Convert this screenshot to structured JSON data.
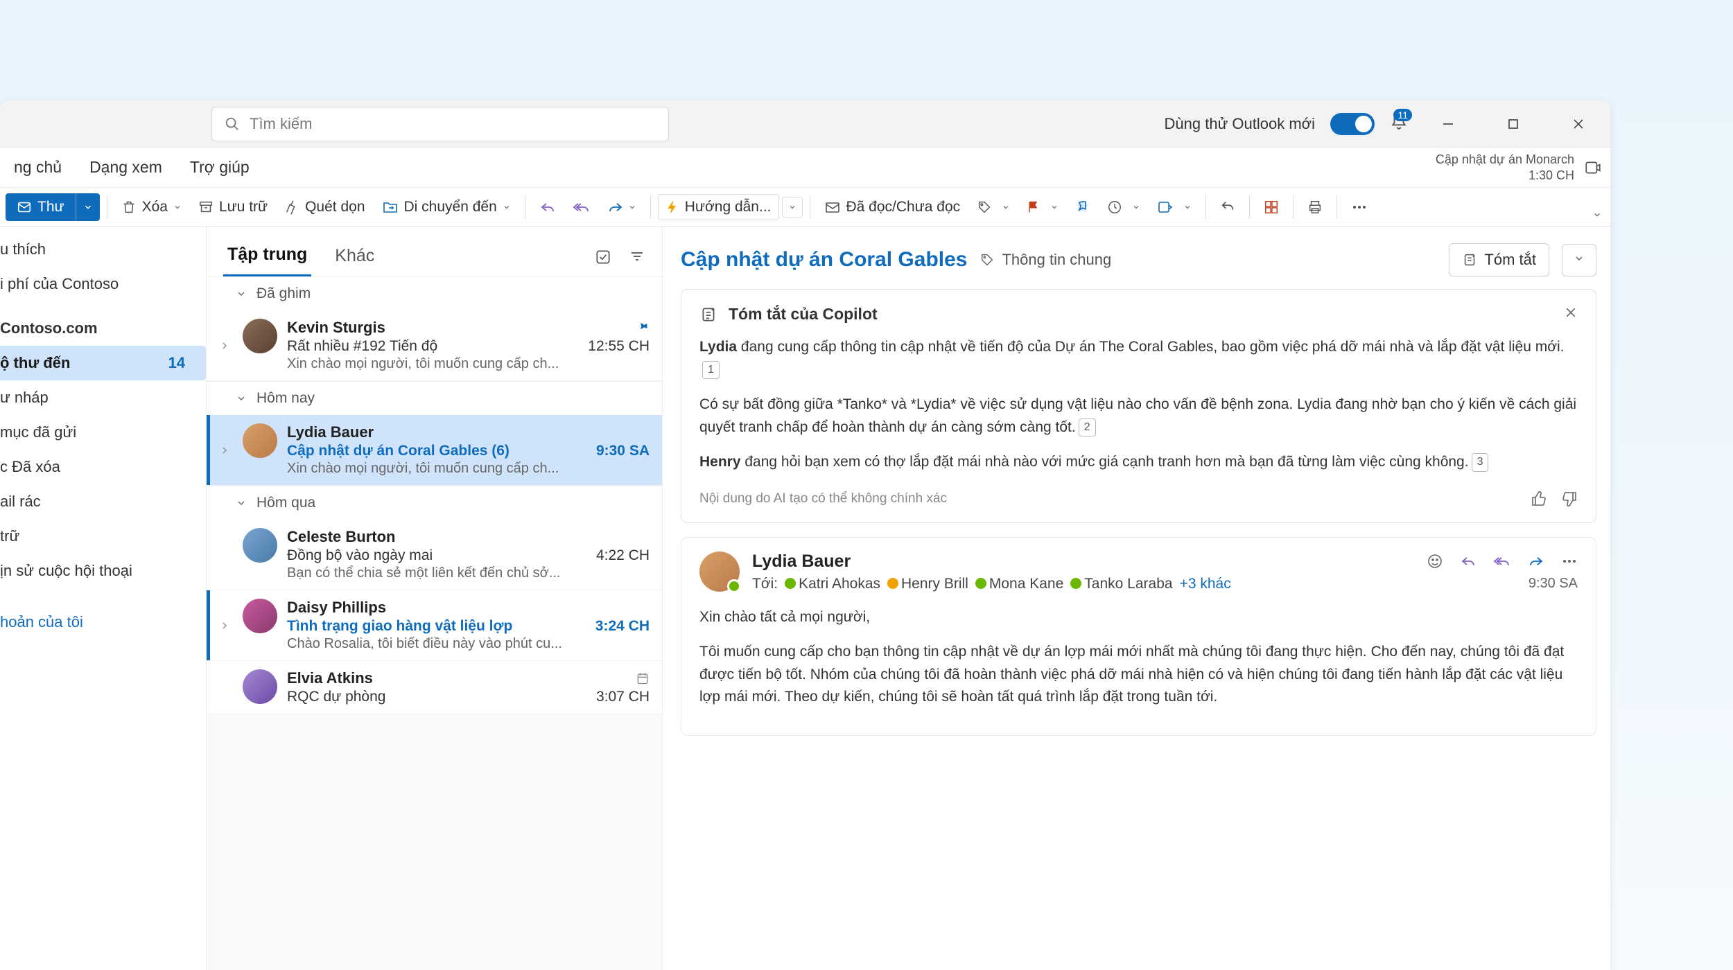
{
  "titlebar": {
    "search_placeholder": "Tìm kiếm",
    "try_new": "Dùng thử Outlook mới",
    "notification_count": "11"
  },
  "tabs": {
    "home": "ng chủ",
    "view": "Dạng xem",
    "help": "Trợ giúp"
  },
  "meeting": {
    "title": "Cập nhật dự án Monarch",
    "time": "1:30 CH"
  },
  "ribbon": {
    "new_mail": "Thư",
    "delete": "Xóa",
    "archive": "Lưu trữ",
    "sweep": "Quét dọn",
    "move": "Di chuyển đến",
    "guide": "Hướng dẫn...",
    "read_unread": "Đã đọc/Chưa đọc"
  },
  "folders": {
    "favorites": "u thích",
    "contoso_fees": "i phí của Contoso",
    "contoso_com": "Contoso.com",
    "inbox": "ộ thư đến",
    "inbox_count": "14",
    "drafts": "ư nháp",
    "sent": " mục đã gửi",
    "deleted": "c Đã xóa",
    "junk": "ail rác",
    "archive": " trữ",
    "history": "ịn sử cuộc hội thoại",
    "my_account": "hoản của tôi"
  },
  "msg_tabs": {
    "focused": "Tập trung",
    "other": "Khác"
  },
  "sections": {
    "pinned": "Đã ghim",
    "today": "Hôm nay",
    "yesterday": "Hôm qua"
  },
  "messages": [
    {
      "sender": "Kevin Sturgis",
      "subject": "Rất nhiều #192 Tiến độ",
      "preview": "Xin chào mọi người, tôi muốn cung cấp ch...",
      "time": "12:55 CH"
    },
    {
      "sender": "Lydia Bauer",
      "subject": "Cập nhật dự án Coral Gables (6)",
      "preview": "Xin chào mọi người, tôi muốn cung cấp ch...",
      "time": "9:30 SA"
    },
    {
      "sender": "Celeste Burton",
      "subject": "Đồng bộ vào ngày mai",
      "preview": "Bạn có thể chia sẻ một liên kết đến chủ sở...",
      "time": "4:22 CH"
    },
    {
      "sender": "Daisy Phillips",
      "subject": "Tình trạng giao hàng vật liệu lợp",
      "preview": "Chào Rosalia, tôi biết điều này vào phút cu...",
      "time": "3:24 CH"
    },
    {
      "sender": "Elvia Atkins",
      "subject": "RQC dự phòng",
      "preview": "",
      "time": "3:07 CH"
    }
  ],
  "reading": {
    "title": "Cập nhật dự án Coral Gables",
    "subtitle": "Thông tin chung",
    "summarize": "Tóm tắt"
  },
  "copilot": {
    "heading": "Tóm tắt của Copilot",
    "p1a": "Lydia",
    "p1b": " đang cung cấp thông tin cập nhật về tiến độ của Dự án The Coral Gables, bao gồm việc phá dỡ mái nhà và lắp đặt vật liệu mới.",
    "p2": "Có sự bất đồng giữa *Tanko* và *Lydia* về việc sử dụng vật liệu nào cho vấn đề bệnh zona. Lydia đang nhờ bạn cho ý kiến về cách giải quyết tranh chấp để hoàn thành dự án càng sớm càng tốt.",
    "p3a": "Henry",
    "p3b": " đang hỏi bạn xem có thợ lắp đặt mái nhà nào với mức giá cạnh tranh hơn mà bạn đã từng làm việc cùng không.",
    "disclaimer": "Nội dung do AI tạo có thể không chính xác"
  },
  "mail": {
    "sender": "Lydia Bauer",
    "to_label": "Tới:",
    "r1": "Katri Ahokas",
    "r2": "Henry Brill",
    "r3": "Mona Kane",
    "r4": "Tanko Laraba",
    "more": "+3 khác",
    "time": "9:30 SA",
    "greeting": "Xin chào tất cả mọi người,",
    "body": "Tôi muốn cung cấp cho bạn thông tin cập nhật về dự án lợp mái mới nhất mà chúng tôi đang thực hiện. Cho đến nay, chúng tôi đã đạt được tiến bộ tốt. Nhóm của chúng tôi đã hoàn thành việc phá dỡ mái nhà hiện có và hiện chúng tôi đang tiến hành lắp đặt các vật liệu lợp mái mới. Theo dự kiến, chúng tôi sẽ hoàn tất quá trình lắp đặt trong tuần tới."
  }
}
